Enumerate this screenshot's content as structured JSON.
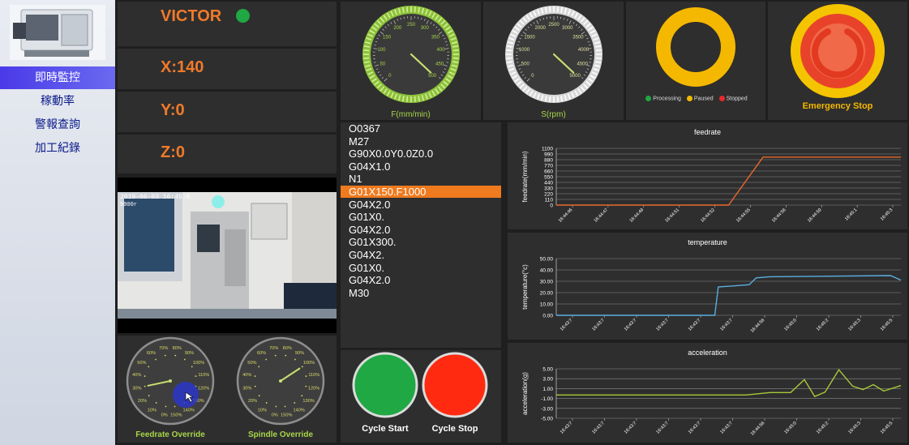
{
  "sidebar": {
    "items": [
      {
        "label": "即時監控",
        "active": true
      },
      {
        "label": "稼動率",
        "active": false
      },
      {
        "label": "警報查詢",
        "active": false
      },
      {
        "label": "加工紀錄",
        "active": false
      }
    ]
  },
  "machine": {
    "name": "VICTOR",
    "status_color": "#1fa843"
  },
  "axes": {
    "x": "X:140",
    "y": "Y:0",
    "z": "Z:0"
  },
  "camera": {
    "timestamp": "2019-06-03 16:45:0",
    "label": "9900r"
  },
  "override": {
    "feed_label": "Feedrate Override",
    "spindle_label": "Spindle Override",
    "ticks": [
      "0%",
      "10%",
      "20%",
      "30%",
      "40%",
      "50%",
      "60%",
      "70%",
      "80%",
      "90%",
      "100%",
      "110%",
      "120%",
      "130%",
      "140%",
      "150%"
    ],
    "feed_value": 30,
    "spindle_value": 100
  },
  "feed_gauge": {
    "label": "F(mm/min)",
    "ticks": [
      "0",
      "50",
      "100",
      "150",
      "200",
      "250",
      "300",
      "350",
      "400",
      "450",
      "500"
    ],
    "value": 500
  },
  "spindle_gauge": {
    "label": "S(rpm)",
    "ticks": [
      "0",
      "500",
      "1000",
      "1500",
      "2000",
      "2500",
      "3000",
      "3500",
      "4000",
      "4500",
      "5000"
    ],
    "value": 5000
  },
  "status_legend": {
    "processing": "Processing",
    "paused": "Paused",
    "stopped": "Stopped"
  },
  "colors": {
    "processing": "#1fa843",
    "paused": "#f5b800",
    "stopped": "#e82a2a",
    "accent": "#f07a1e",
    "gauge_green": "#a8d54a"
  },
  "emergency": {
    "label": "Emergency Stop"
  },
  "program": {
    "lines": [
      "O0367",
      "M27",
      "G90X0.0Y0.0Z0.0",
      "G04X1.0",
      "N1",
      "G01X150.F1000",
      "G04X2.0",
      "G01X0.",
      "G04X2.0",
      "G01X300.",
      "G04X2.",
      "G01X0.",
      "G04X2.0",
      "M30"
    ],
    "selected_index": 5
  },
  "buttons": {
    "cycle_start": "Cycle Start",
    "cycle_stop": "Cycle Stop"
  },
  "chart_data": [
    {
      "type": "line",
      "title": "feedrate",
      "ylabel": "feedrate(mm/min)",
      "ylim": [
        0,
        1100
      ],
      "yticks": [
        0,
        110,
        220,
        330,
        440,
        550,
        660,
        770,
        880,
        990,
        1100
      ],
      "xticks": [
        "16:44:46",
        "16:44:47",
        "16:44:49",
        "16:44:51",
        "16:44:52",
        "16:44:55",
        "16:44:56",
        "16:44:59",
        "16:45:1",
        "16:45:3"
      ],
      "series": [
        {
          "color": "#e8682a",
          "x": [
            0,
            0.5,
            0.6,
            1
          ],
          "y": [
            0,
            0,
            930,
            930
          ]
        }
      ]
    },
    {
      "type": "line",
      "title": "temperature",
      "ylabel": "temperature(°c)",
      "ylim": [
        0,
        50
      ],
      "yticks": [
        "0.00",
        "10.00",
        "20.00",
        "30.00",
        "40.00",
        "50.00"
      ],
      "xticks": [
        "16:43:7",
        "16:43:7",
        "16:43:7",
        "16:43:7",
        "16:43:7",
        "16:43:7",
        "16:44:56",
        "16:45:0",
        "16:45:2",
        "16:45:3",
        "16:45:5"
      ],
      "series": [
        {
          "color": "#5aaee0",
          "x": [
            0,
            0.46,
            0.47,
            0.52,
            0.56,
            0.58,
            0.62,
            0.97,
            1
          ],
          "y": [
            0,
            0,
            25,
            26,
            27,
            33,
            34,
            35,
            31
          ]
        }
      ]
    },
    {
      "type": "line",
      "title": "acceleration",
      "ylabel": "acceleration(g)",
      "ylim": [
        -5,
        5
      ],
      "yticks": [
        "5.00",
        "3.00",
        "1.00",
        "-1.00",
        "-3.00",
        "-5.00"
      ],
      "xticks": [
        "16:43:7",
        "16:43:7",
        "16:43:7",
        "16:43:7",
        "16:43:7",
        "16:43:7",
        "16:44:56",
        "16:45:0",
        "16:45:2",
        "16:45:3",
        "16:45:5"
      ],
      "series": [
        {
          "color": "#a8c83a",
          "x": [
            0,
            0.55,
            0.62,
            0.68,
            0.72,
            0.75,
            0.78,
            0.82,
            0.86,
            0.89,
            0.92,
            0.95,
            1
          ],
          "y": [
            -0.3,
            -0.3,
            0.2,
            0.2,
            2.8,
            -0.6,
            0.3,
            4.8,
            1.5,
            0.8,
            1.8,
            0.5,
            1.6
          ]
        }
      ]
    }
  ]
}
